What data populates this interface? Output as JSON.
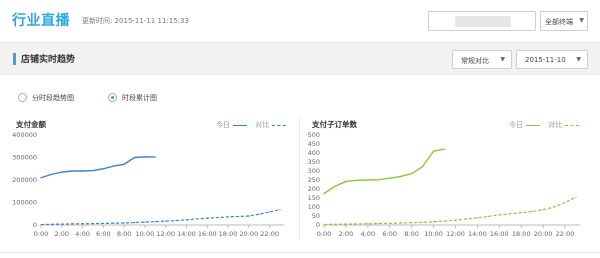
{
  "header": {
    "title": "行业直播",
    "update_time": "更新时间: 2015-11-11  11:15:33",
    "industry_select": "全部终端"
  },
  "section": {
    "title": "店铺实时趋势",
    "compare_select": "常规对比",
    "date_select": "2015-11-10"
  },
  "view_mode": {
    "options": [
      "分时段趋势图",
      "时段累计图"
    ],
    "selected": "时段累计图"
  },
  "colors": {
    "accent": "#2ea7e0",
    "payment_series": "#3a7fd5",
    "orders_series": "#8cc63f",
    "section_bg": "#f2f2f2"
  },
  "legend": {
    "today": "今日",
    "compare": "对比"
  },
  "chart_data": [
    {
      "type": "line",
      "title": "支付金额",
      "categories": [
        "0:00",
        "2:00",
        "4:00",
        "6:00",
        "8:00",
        "10:00",
        "12:00",
        "14:00",
        "16:00",
        "18:00",
        "20:00",
        "22:00"
      ],
      "ylim": [
        0,
        400000
      ],
      "yticks": [
        0,
        100000,
        200000,
        300000,
        400000
      ],
      "grid": false,
      "legend_position": "top-right",
      "series": [
        {
          "name": "今日",
          "style": "solid",
          "x": [
            0,
            1,
            2,
            3,
            4,
            5,
            6,
            7,
            8,
            9,
            10,
            11
          ],
          "values": [
            210000,
            225000,
            235000,
            240000,
            240000,
            242000,
            250000,
            262000,
            270000,
            300000,
            303000,
            302000
          ]
        },
        {
          "name": "对比",
          "style": "dashed",
          "x": [
            0,
            1,
            2,
            3,
            4,
            5,
            6,
            7,
            8,
            9,
            10,
            11,
            12,
            13,
            14,
            15,
            16,
            17,
            18,
            19,
            20,
            21,
            22,
            23
          ],
          "values": [
            2000,
            3000,
            4000,
            5000,
            5500,
            6000,
            7000,
            8000,
            9000,
            11000,
            13000,
            15000,
            17000,
            20000,
            23000,
            27000,
            30000,
            33000,
            36000,
            38000,
            40000,
            48000,
            58000,
            68000
          ]
        }
      ]
    },
    {
      "type": "line",
      "title": "支付子订单数",
      "categories": [
        "0:00",
        "2:00",
        "4:00",
        "6:00",
        "8:00",
        "10:00",
        "12:00",
        "14:00",
        "16:00",
        "18:00",
        "20:00",
        "22:00"
      ],
      "ylim": [
        0,
        500
      ],
      "yticks": [
        0,
        50,
        100,
        150,
        200,
        250,
        300,
        350,
        400,
        450,
        500
      ],
      "grid": false,
      "legend_position": "top-right",
      "series": [
        {
          "name": "今日",
          "style": "solid",
          "x": [
            0,
            1,
            2,
            3,
            4,
            5,
            6,
            7,
            8,
            9,
            10,
            11
          ],
          "values": [
            175,
            215,
            242,
            248,
            250,
            252,
            260,
            270,
            285,
            325,
            410,
            422
          ]
        },
        {
          "name": "对比",
          "style": "dashed",
          "x": [
            0,
            1,
            2,
            3,
            4,
            5,
            6,
            7,
            8,
            9,
            10,
            11,
            12,
            13,
            14,
            15,
            16,
            17,
            18,
            19,
            20,
            21,
            22,
            23
          ],
          "values": [
            3,
            4,
            5,
            6,
            7,
            8,
            9,
            11,
            13,
            15,
            18,
            22,
            27,
            33,
            40,
            48,
            56,
            62,
            68,
            75,
            85,
            100,
            125,
            155
          ]
        }
      ]
    }
  ]
}
